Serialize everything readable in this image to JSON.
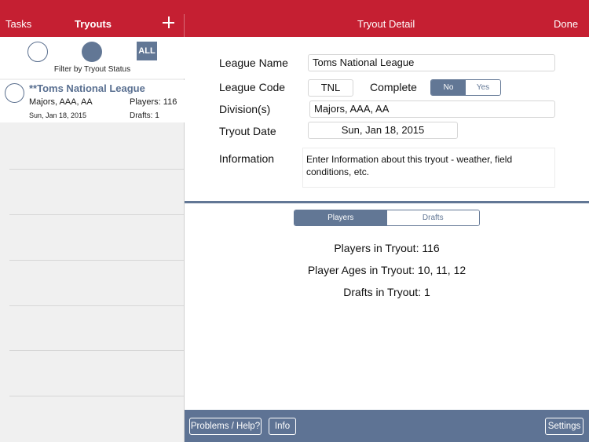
{
  "header": {
    "left_button": "Tasks",
    "list_title": "Tryouts",
    "add_icon": "plus-icon",
    "detail_title": "Tryout Detail",
    "done_button": "Done"
  },
  "filter": {
    "all_label": "ALL",
    "caption": "Filter by Tryout Status"
  },
  "tryouts": [
    {
      "name": "**Toms National League",
      "divisions": "Majors, AAA, AA",
      "players": "Players: 116",
      "date": "Sun, Jan 18, 2015",
      "drafts": "Drafts: 1"
    }
  ],
  "form": {
    "league_name_label": "League Name",
    "league_name_value": "Toms National League",
    "league_code_label": "League Code",
    "league_code_value": "TNL",
    "complete_label": "Complete",
    "complete_options": [
      "No",
      "Yes"
    ],
    "complete_selected": "No",
    "divisions_label": "Division(s)",
    "divisions_value": "Majors, AAA, AA",
    "tryout_date_label": "Tryout Date",
    "tryout_date_value": "Sun, Jan 18, 2015",
    "information_label": "Information",
    "information_placeholder": "Enter Information about this tryout - weather, field conditions, etc."
  },
  "tabs": {
    "players": "Players",
    "drafts": "Drafts",
    "selected": "Players"
  },
  "stats": {
    "players": "Players in Tryout: 116",
    "ages": "Player Ages in Tryout: 10, 11, 12",
    "drafts": "Drafts in Tryout: 1"
  },
  "footer": {
    "help_button": "Problems / Help?",
    "info_button": "Info",
    "settings_button": "Settings"
  },
  "colors": {
    "header_red": "#c51f32",
    "accent_slate": "#627795",
    "title_blue": "#5a7091"
  }
}
